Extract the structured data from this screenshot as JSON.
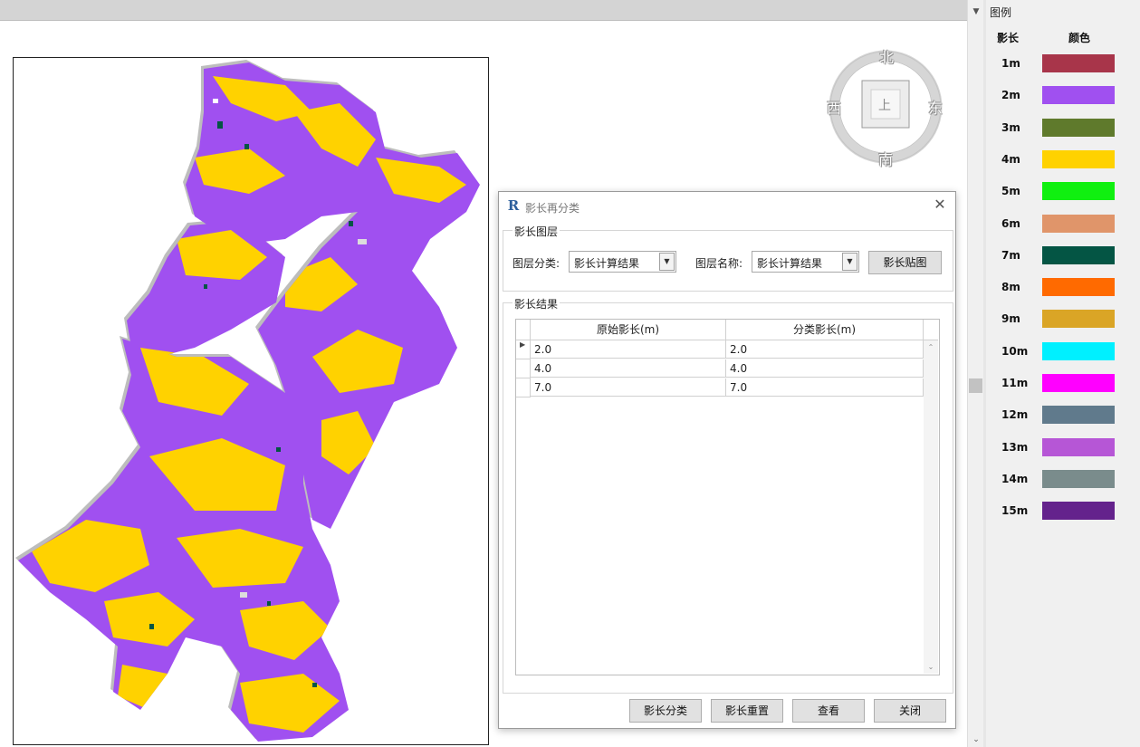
{
  "legend": {
    "title": "图例",
    "col_length": "影长",
    "col_color": "颜色",
    "items": [
      {
        "label": "1m",
        "color": "#a8354a"
      },
      {
        "label": "2m",
        "color": "#a050f0"
      },
      {
        "label": "3m",
        "color": "#5f7a2c"
      },
      {
        "label": "4m",
        "color": "#ffd200"
      },
      {
        "label": "5m",
        "color": "#10f010"
      },
      {
        "label": "6m",
        "color": "#e0956a"
      },
      {
        "label": "7m",
        "color": "#045544"
      },
      {
        "label": "8m",
        "color": "#ff6a00"
      },
      {
        "label": "9m",
        "color": "#daa526"
      },
      {
        "label": "10m",
        "color": "#00f0ff"
      },
      {
        "label": "11m",
        "color": "#ff00ff"
      },
      {
        "label": "12m",
        "color": "#607a8c"
      },
      {
        "label": "13m",
        "color": "#b656d6"
      },
      {
        "label": "14m",
        "color": "#7a8c8c"
      },
      {
        "label": "15m",
        "color": "#64228c"
      }
    ]
  },
  "compass": {
    "north": "北",
    "south": "南",
    "east": "东",
    "west": "西",
    "center": "上"
  },
  "dialog": {
    "title": "影长再分类",
    "group_layer": "影长图层",
    "layer_category_label": "图层分类:",
    "layer_category_value": "影长计算结果",
    "layer_name_label": "图层名称:",
    "layer_name_value": "影长计算结果",
    "map_button": "影长贴图",
    "group_result": "影长结果",
    "columns": [
      "原始影长(m)",
      "分类影长(m)"
    ],
    "rows": [
      {
        "original": "2.0",
        "classified": "2.0"
      },
      {
        "original": "4.0",
        "classified": "4.0"
      },
      {
        "original": "7.0",
        "classified": "7.0"
      }
    ],
    "buttons": {
      "classify": "影长分类",
      "reset": "影长重置",
      "view": "查看",
      "close": "关闭"
    }
  },
  "map": {
    "colors": {
      "purple": "#a050f0",
      "yellow": "#ffd200",
      "green": "#045544",
      "shadow": "#b8b8b8"
    }
  }
}
